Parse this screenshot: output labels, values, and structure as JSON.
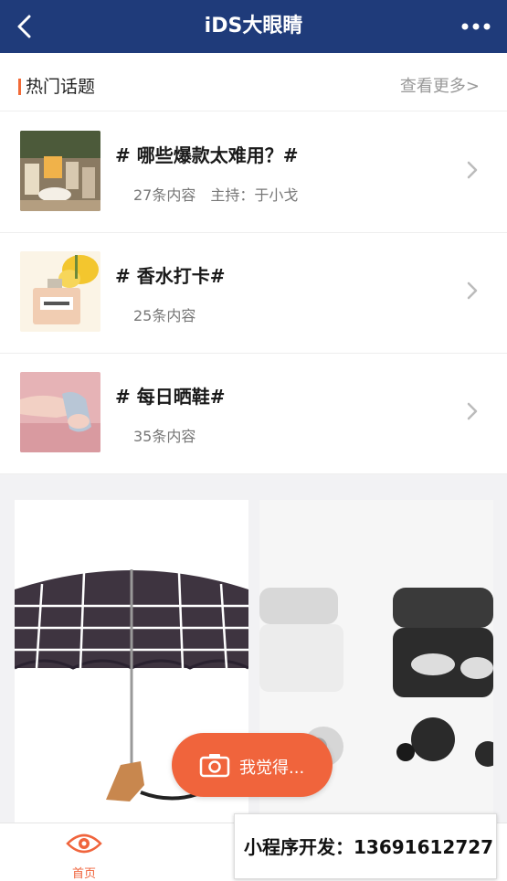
{
  "header": {
    "title": "iDS大眼睛"
  },
  "hot_topics": {
    "heading": "热门话题",
    "more_label": "查看更多>",
    "items": [
      {
        "title": "# 哪些爆款太难用？#",
        "count": "27条内容",
        "host": "主持：于小戈"
      },
      {
        "title": "# 香水打卡#",
        "count": "25条内容"
      },
      {
        "title": "# 每日晒鞋#",
        "count": "35条内容"
      }
    ]
  },
  "fab": {
    "label": "我觉得..."
  },
  "tabbar": {
    "home_label": "首页"
  },
  "promo": {
    "text": "小程序开发：13691612727"
  },
  "colors": {
    "header_bg": "#1f3b7a",
    "accent": "#f0643c"
  },
  "icons": {
    "back": "back-arrow-icon",
    "more": "more-dots-icon",
    "chevron": "chevron-right-icon",
    "camera": "camera-icon",
    "home": "eye-icon"
  }
}
